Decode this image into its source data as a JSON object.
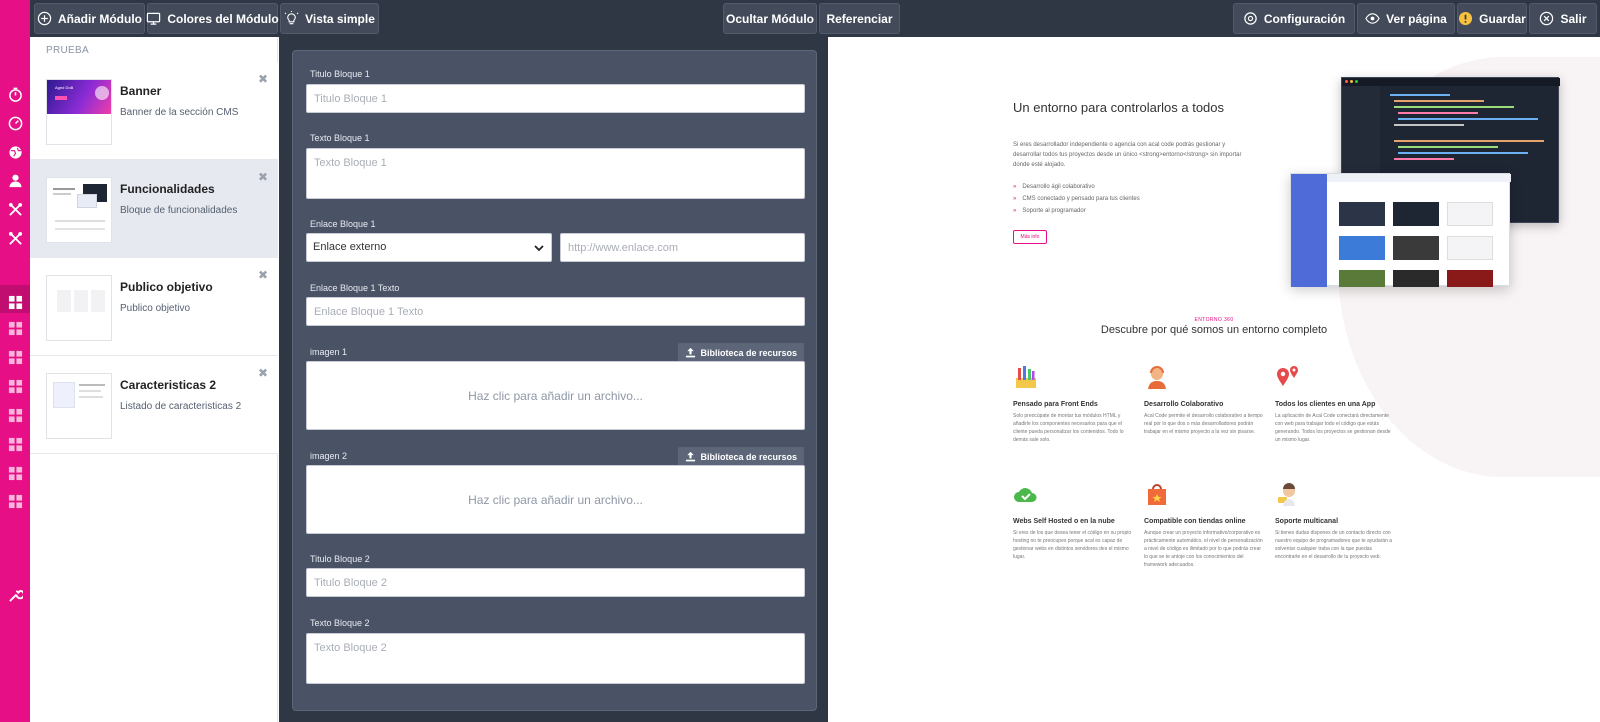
{
  "toolbar": {
    "add_module": "Añadir Módulo",
    "module_colors": "Colores del Módulo",
    "simple_view": "Vista simple",
    "hide_module": "Ocultar Módulo",
    "reference": "Referenciar",
    "settings": "Configuración",
    "view_page": "Ver página",
    "save": "Guardar",
    "exit": "Salir"
  },
  "colors": {
    "accent": "#e60f86",
    "topbar": "#2f3644",
    "panel": "#4a5265"
  },
  "rail_icons": [
    "stopwatch-icon",
    "dashboard-icon",
    "globe-icon",
    "user-icon",
    "tools-icon",
    "tools-icon",
    "modules-icon",
    "modules-icon",
    "modules-icon",
    "modules-icon",
    "modules-icon",
    "modules-icon",
    "modules-icon",
    "modules-icon",
    "wrench-icon"
  ],
  "module_list": {
    "section": "PRUEBA",
    "items": [
      {
        "title": "Banner",
        "subtitle": "Banner de la sección CMS",
        "thumb_title": "Aged Dolli"
      },
      {
        "title": "Funcionalidades",
        "subtitle": "Bloque de funcionalidades"
      },
      {
        "title": "Publico objetivo",
        "subtitle": "Publico objetivo"
      },
      {
        "title": "Caracteristicas 2",
        "subtitle": "Listado de caracteristicas 2"
      }
    ]
  },
  "form": {
    "titulo1_label": "Titulo Bloque 1",
    "titulo1_placeholder": "Titulo Bloque 1",
    "texto1_label": "Texto Bloque 1",
    "texto1_placeholder": "Texto Bloque 1",
    "enlace1_label": "Enlace Bloque 1",
    "enlace1_select": "Enlace externo",
    "enlace1_url_placeholder": "http://www.enlace.com",
    "enlace1_texto_label": "Enlace Bloque 1 Texto",
    "enlace1_texto_placeholder": "Enlace Bloque 1 Texto",
    "imagen1_label": "imagen 1",
    "imagen2_label": "imagen 2",
    "library_button": "Biblioteca de recursos",
    "drop_text": "Haz clic para añadir un archivo...",
    "titulo2_label": "Titulo Bloque 2",
    "titulo2_placeholder": "Titulo Bloque 2",
    "texto2_label": "Texto Bloque 2",
    "texto2_placeholder": "Texto Bloque 2"
  },
  "preview": {
    "hero_title": "Un entorno para controlarlos a todos",
    "hero_text": "Si eres desarrollador independiente o agencia con acal code podrás gestionar y desarrollar todos tus proyectos desde un único <strong>entorno</strong> sin importar donde esté alojado.",
    "bullets": [
      "Desarrollo ágil colaborativo",
      "CMS conectado y pensado para tus clientes",
      "Soporte al programador"
    ],
    "button": "Más info",
    "tag": "ENTORNO 360",
    "section_title": "Descubre por qué somos un entorno completo",
    "features": [
      {
        "title": "Pensado para Front Ends",
        "text": "Solo preocúpate de montar tus módulos HTML y añadirle los componentes necesarios para que el cliente pueda personalizar los contenidos. Todo lo demás sale solo."
      },
      {
        "title": "Desarrollo Colaborativo",
        "text": "Acal Code permite el desarrollo colaborativo a tiempo real por lo que dos o más desarrolladores podrán trabajar en el mismo proyecto a la vez sin pisarse."
      },
      {
        "title": "Todos los clientes en una App",
        "text": "La aplicación de Acal Code conectará directamente con web para trabajar todo el código que estás generando. Todos los proyectos se gestionan desde un mismo lugar."
      },
      {
        "title": "Webs Self Hosted o en la nube",
        "text": "Si eres de los que desea tener el código en su propio hosting no te preocupes porque acal es capaz de gestionar webs en distintos servidores des el mismo lugar."
      },
      {
        "title": "Compatible con tiendas online",
        "text": "Aunque crear un proyecto informativo/corporativo es prácticamente automático, el nivel de personalización a nivel de código es ilimitado por lo que podrás crear lo que se te antoje con los conocimientos del framework adecuados."
      },
      {
        "title": "Soporte multicanal",
        "text": "Si tienes dudas dispones de un contacto directo con nuestro equipo de programadores que te ayudarán a solventar cualquier traba con la que puedas encontrarte en el desarrollo de tu proyecto web."
      }
    ]
  }
}
